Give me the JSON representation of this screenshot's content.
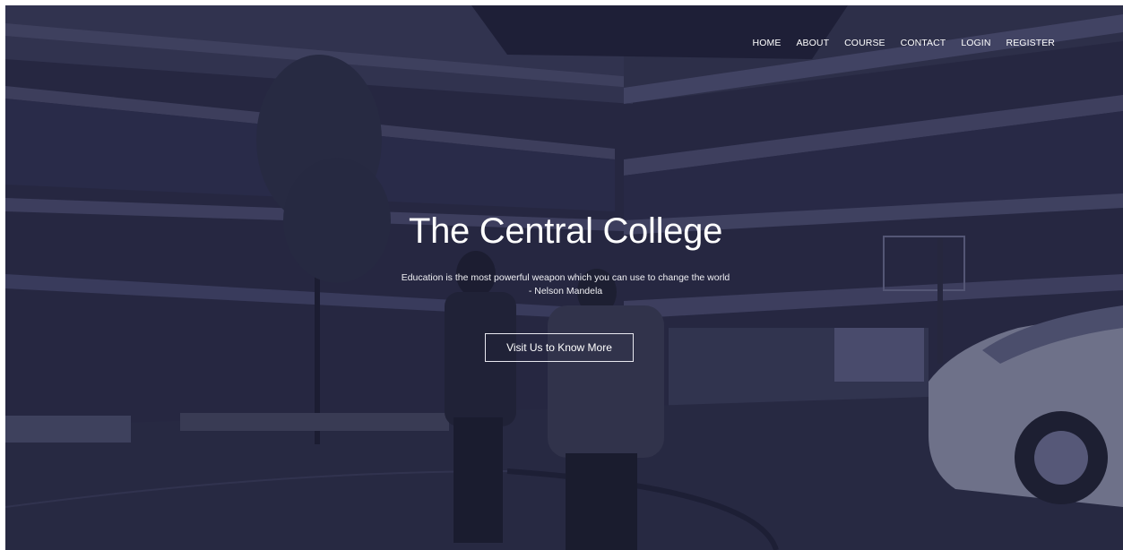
{
  "nav": {
    "items": [
      "HOME",
      "ABOUT",
      "COURSE",
      "CONTACT",
      "LOGIN",
      "REGISTER"
    ]
  },
  "hero": {
    "title": "The Central College",
    "quote_line1": "Education is the most powerful weapon which you can use to change the world",
    "quote_line2": "- Nelson Mandela",
    "cta_label": "Visit Us to Know More"
  },
  "colors": {
    "overlay": "#1e1e3a",
    "text": "#ffffff"
  }
}
